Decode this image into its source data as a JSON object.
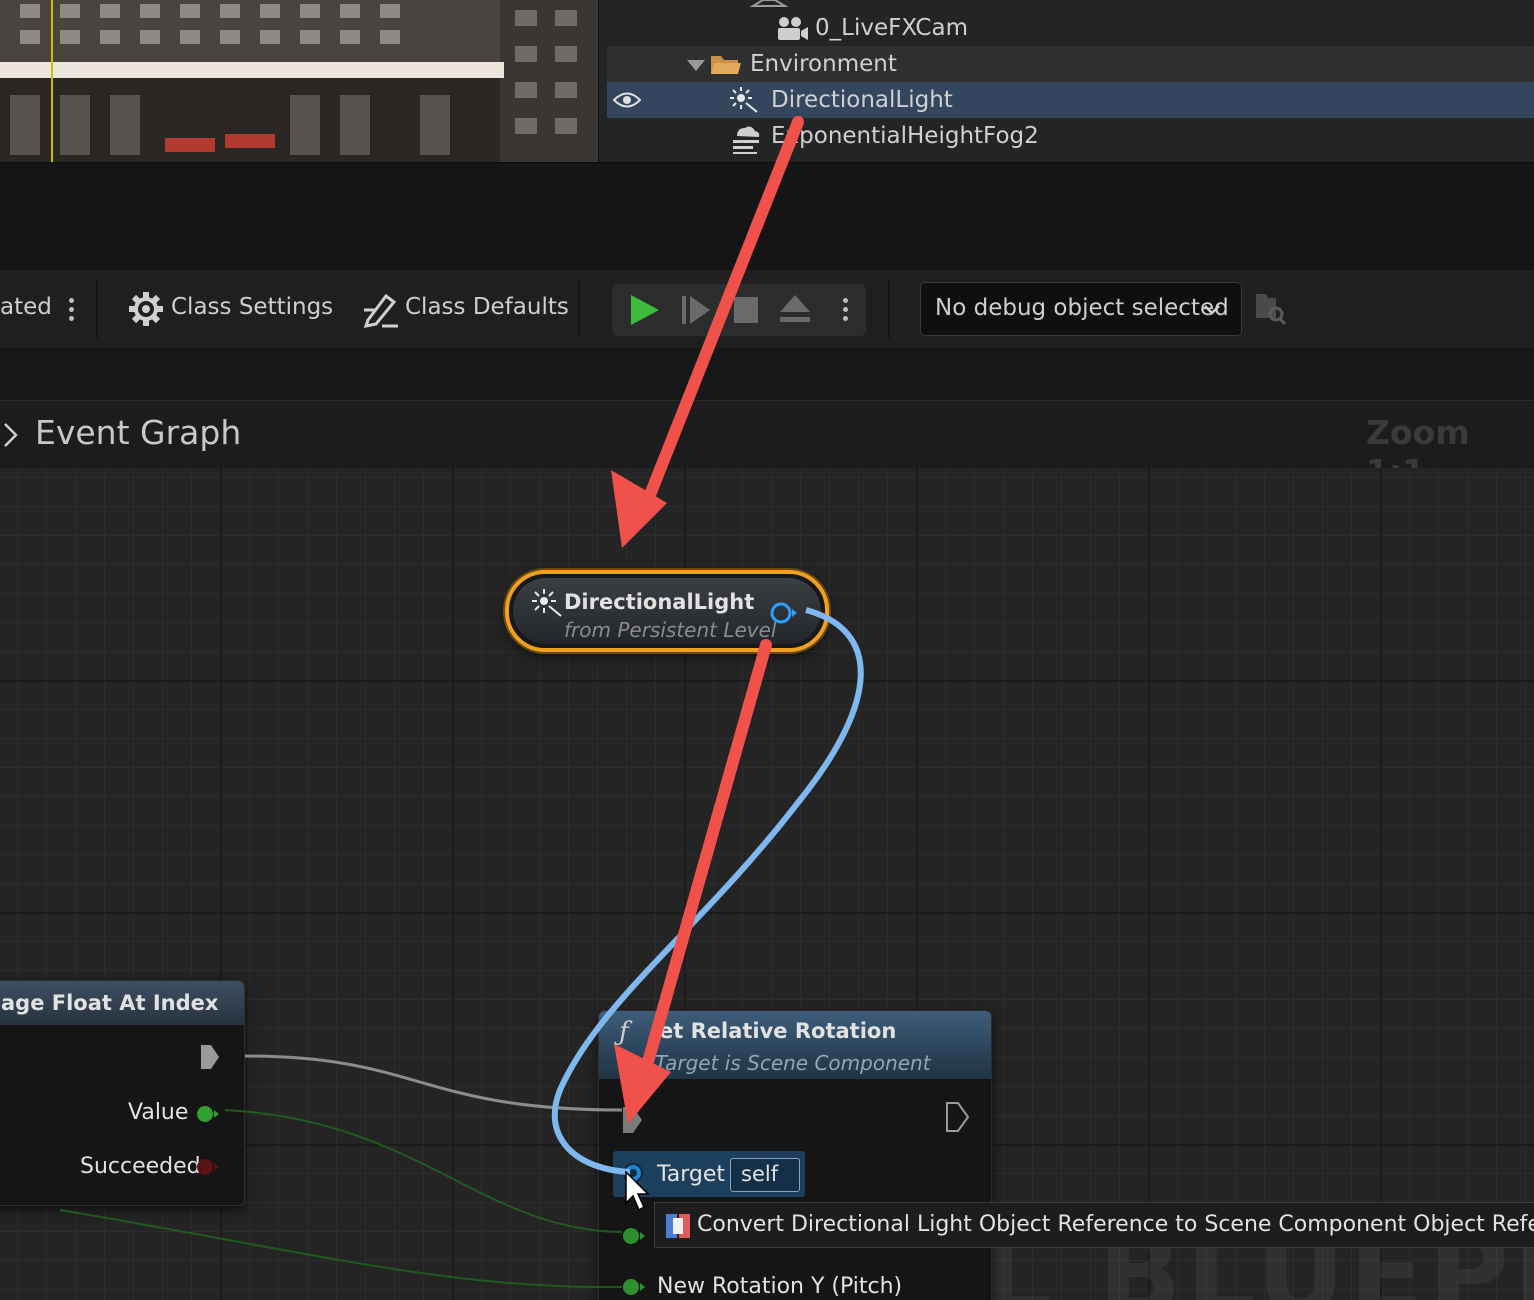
{
  "outliner": {
    "items": [
      {
        "label": "0_LiveFXCam",
        "icon": "camera-actor-icon"
      },
      {
        "label": "Environment",
        "icon": "folder-icon"
      },
      {
        "label": "DirectionalLight",
        "icon": "directional-light-icon"
      },
      {
        "label": "ExponentialHeightFog2",
        "icon": "fog-icon"
      }
    ]
  },
  "toolbar": {
    "truncated_label": "ated",
    "class_settings": "Class Settings",
    "class_defaults": "Class Defaults",
    "debug_select": "No debug object selected"
  },
  "graph": {
    "title": "Event Graph",
    "zoom": "Zoom 1:1",
    "watermark": "LEVEL BLUEPRINT"
  },
  "nodes": {
    "directional_light": {
      "title": "DirectionalLight",
      "subtitle": "from Persistent Level"
    },
    "get_float": {
      "title": "age Float At Index",
      "pin_value": "Value",
      "pin_succeeded": "Succeeded"
    },
    "set_rotation": {
      "title": "et Relative Rotation",
      "subtitle": "Target is Scene Component",
      "pin_target": "Target",
      "pin_target_default": "self",
      "pin_pitch": "New Rotation Y (Pitch)"
    }
  },
  "tooltip": {
    "text": "Convert Directional Light Object Reference to Scene Component Object Reference"
  },
  "colors": {
    "selection": "#34465e",
    "node_highlight": "#f0a020",
    "object_pin": "#2aa0ff",
    "wire": "#7fb8ef",
    "annotation_arrow": "#f0524b",
    "play_green": "#3dbb3d"
  }
}
